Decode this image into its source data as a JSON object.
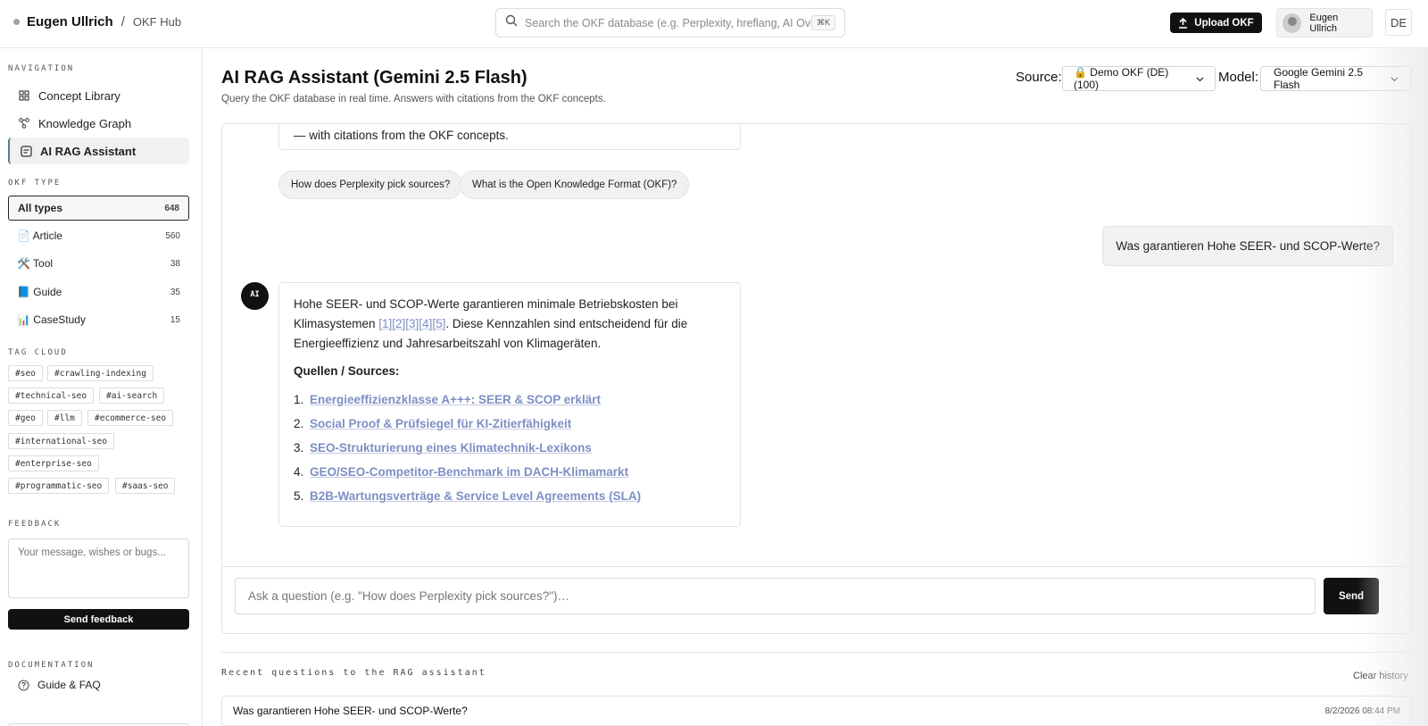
{
  "header": {
    "user_name": "Eugen Ullrich",
    "separator": "/",
    "hub": "OKF Hub",
    "search_placeholder": "Search the OKF database (e.g. Perplexity, hreflang, AI Overviews)",
    "search_shortcut": "⌘K",
    "upload_label": "Upload OKF",
    "account_name": "Eugen Ullrich",
    "language": "DE"
  },
  "sidebar": {
    "navigation_title": "NAVIGATION",
    "nav": [
      {
        "label": "Concept Library",
        "icon": "grid-icon"
      },
      {
        "label": "Knowledge Graph",
        "icon": "graph-icon"
      },
      {
        "label": "AI RAG Assistant",
        "icon": "document-icon"
      }
    ],
    "okf_type_title": "OKF TYPE",
    "types": [
      {
        "label": "All types",
        "count": "648"
      },
      {
        "label": "📄 Article",
        "count": "560"
      },
      {
        "label": "🛠️ Tool",
        "count": "38"
      },
      {
        "label": "📘 Guide",
        "count": "35"
      },
      {
        "label": "📊 CaseStudy",
        "count": "15"
      }
    ],
    "tag_cloud_title": "TAG CLOUD",
    "tags": [
      "#seo",
      "#crawling-indexing",
      "#technical-seo",
      "#ai-search",
      "#geo",
      "#llm",
      "#ecommerce-seo",
      "#international-seo",
      "#enterprise-seo",
      "#programmatic-seo",
      "#saas-seo"
    ],
    "feedback_title": "FEEDBACK",
    "feedback_placeholder": "Your message, wishes or bugs...",
    "send_feedback_label": "Send feedback",
    "documentation_title": "DOCUMENTATION",
    "doc_item": "Guide & FAQ"
  },
  "main": {
    "title": "AI RAG Assistant (Gemini 2.5 Flash)",
    "subtitle": "Query the OKF database in real time. Answers with citations from the OKF concepts.",
    "source_label": "Source:",
    "source_value": "🔒 Demo OKF (DE) (100)",
    "model_label": "Model:",
    "model_value": "Google Gemini 2.5 Flash"
  },
  "chat": {
    "intro_tail": "— with citations from the OKF concepts.",
    "suggestions": [
      "How does Perplexity pick sources?",
      "What is the Open Knowledge Format (OKF)?"
    ],
    "user_question": "Was garantieren Hohe SEER- und SCOP-Werte?",
    "ai_avatar": "AI",
    "answer_part1": "Hohe SEER- und SCOP-Werte garantieren minimale Betriebskosten bei Klimasystemen ",
    "answer_citations": "[1][2][3][4][5]",
    "answer_part2": ". Diese Kennzahlen sind entscheidend für die Energieeffizienz und Jahresarbeitszahl von Klimageräten.",
    "sources_heading": "Quellen / Sources:",
    "sources": [
      "Energieeffizienzklasse A+++: SEER & SCOP erklärt",
      "Social Proof & Prüfsiegel für KI-Zitierfähigkeit",
      "SEO-Strukturierung eines Klimatechnik-Lexikons",
      "GEO/SEO-Competitor-Benchmark im DACH-Klimamarkt",
      "B2B-Wartungsverträge & Service Level Agreements (SLA)"
    ],
    "input_placeholder": "Ask a question (e.g. \"How does Perplexity pick sources?\")…",
    "send_label": "Send"
  },
  "recent": {
    "title": "Recent questions to the RAG assistant",
    "clear_label": "Clear history",
    "items": [
      {
        "question": "Was garantieren Hohe SEER- und SCOP-Werte?",
        "timestamp": "8/2/2026 08:44 PM"
      }
    ]
  }
}
